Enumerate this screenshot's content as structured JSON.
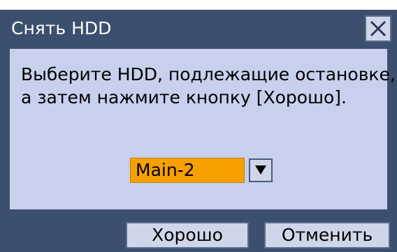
{
  "dialog": {
    "title": "Снять HDD",
    "message_line1": "Выберите HDD, подлежащие остановке,",
    "message_line2": "а затем нажмите кнопку [Хорошо].",
    "hdd_select": {
      "selected": "Main-2",
      "arrow_icon": "triangle-down-icon"
    },
    "buttons": {
      "ok_label": "Хорошо",
      "cancel_label": "Отменить"
    },
    "close_icon": "close-x-icon",
    "colors": {
      "title_bar": "#3d4f6e",
      "panel": "#c7d0ec",
      "select_highlight": "#f7a000",
      "button_face": "#cfd6ea"
    }
  }
}
